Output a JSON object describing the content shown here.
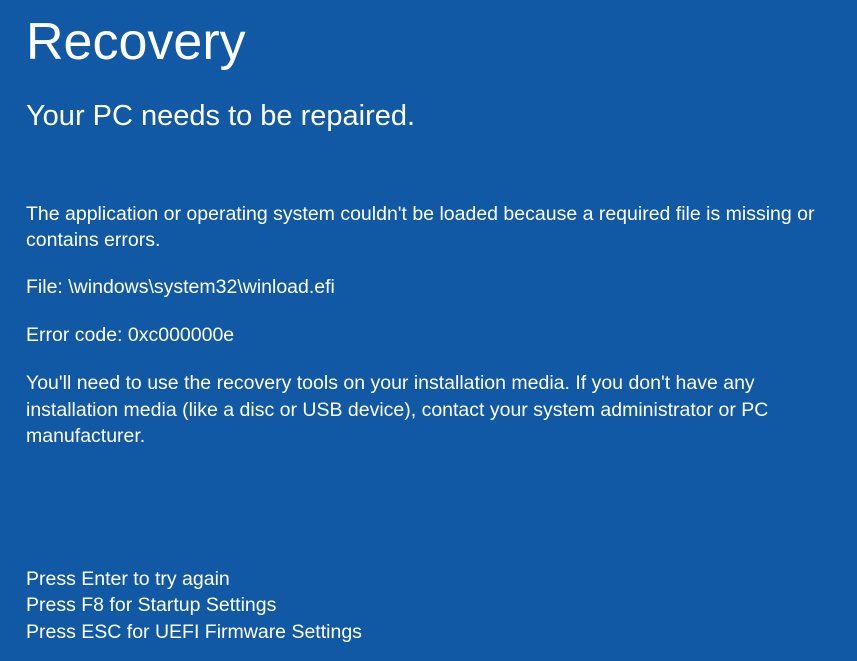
{
  "title": "Recovery",
  "subtitle": "Your PC needs to be repaired.",
  "body": {
    "message": "The application or operating system couldn't be loaded because a required file is missing or contains errors.",
    "file_label": "File:",
    "file_path": "\\windows\\system32\\winload.efi",
    "error_label": "Error code:",
    "error_code": "0xc000000e",
    "instructions": "You'll need to use the recovery tools on your installation media. If you don't have any installation media (like a disc or USB device), contact your system administrator or PC manufacturer."
  },
  "footer": {
    "line_enter": "Press Enter to try again",
    "line_f8": "Press F8 for Startup Settings",
    "line_esc": "Press ESC for UEFI Firmware Settings"
  }
}
